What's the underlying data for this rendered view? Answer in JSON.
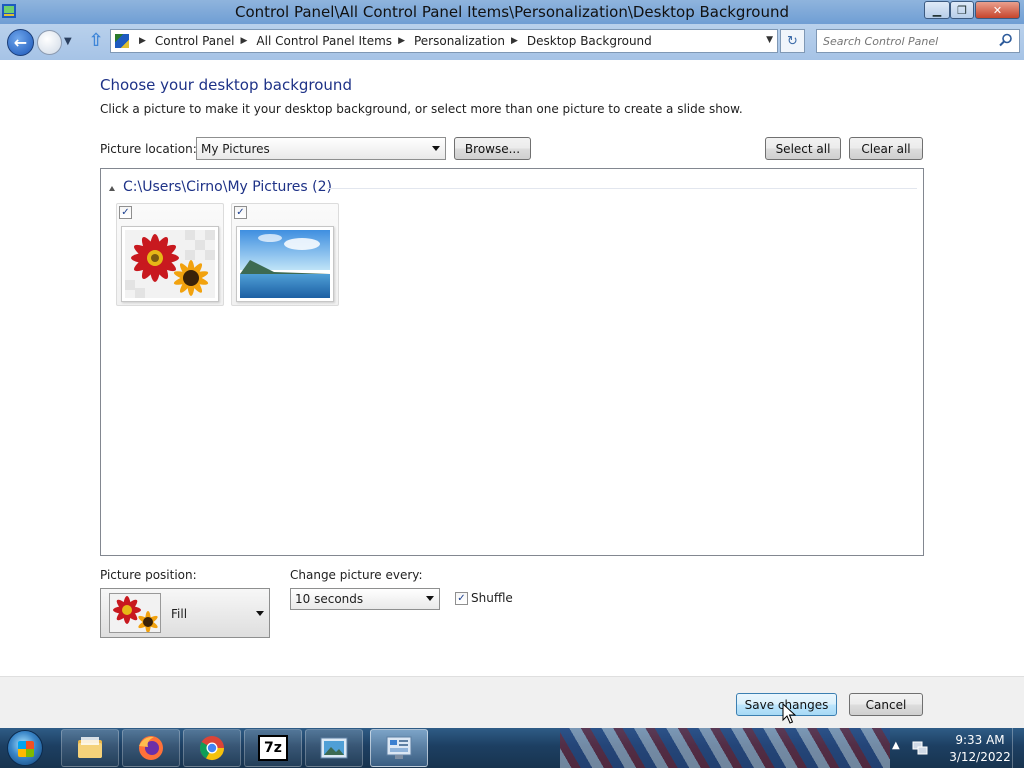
{
  "window": {
    "title": "Control Panel\\All Control Panel Items\\Personalization\\Desktop Background",
    "minimize_glyph": "▁",
    "maximize_glyph": "❐",
    "close_glyph": "✕"
  },
  "address": {
    "breadcrumb": [
      "Control Panel",
      "All Control Panel Items",
      "Personalization",
      "Desktop Background"
    ],
    "search_placeholder": "Search Control Panel"
  },
  "page": {
    "title": "Choose your desktop background",
    "description": "Click a picture to make it your desktop background, or select more than one picture to create a slide show."
  },
  "picture_location": {
    "label": "Picture location:",
    "value": "My Pictures",
    "browse_label": "Browse...",
    "select_all_label": "Select all",
    "clear_all_label": "Clear all"
  },
  "gallery": {
    "group_title": "C:\\Users\\Cirno\\My Pictures (2)",
    "items": [
      {
        "name": "flowers",
        "checked": true,
        "check_glyph": "✓"
      },
      {
        "name": "landscape",
        "checked": true,
        "check_glyph": "✓"
      }
    ]
  },
  "picture_position": {
    "label": "Picture position:",
    "value": "Fill"
  },
  "change_picture": {
    "label": "Change picture every:",
    "value": "10 seconds",
    "shuffle_label": "Shuffle",
    "shuffle_checked": true,
    "check_glyph": "✓"
  },
  "footer": {
    "save_label": "Save changes",
    "cancel_label": "Cancel"
  },
  "taskbar": {
    "pinned": [
      "windows-explorer",
      "firefox",
      "chrome",
      "7-zip",
      "photo-viewer",
      "control-panel"
    ],
    "seven_zip_label": "7z",
    "clock_time": "9:33 AM",
    "clock_date": "3/12/2022"
  },
  "colors": {
    "heading_blue": "#1e3287",
    "save_button_blue": "#bee6fd"
  }
}
